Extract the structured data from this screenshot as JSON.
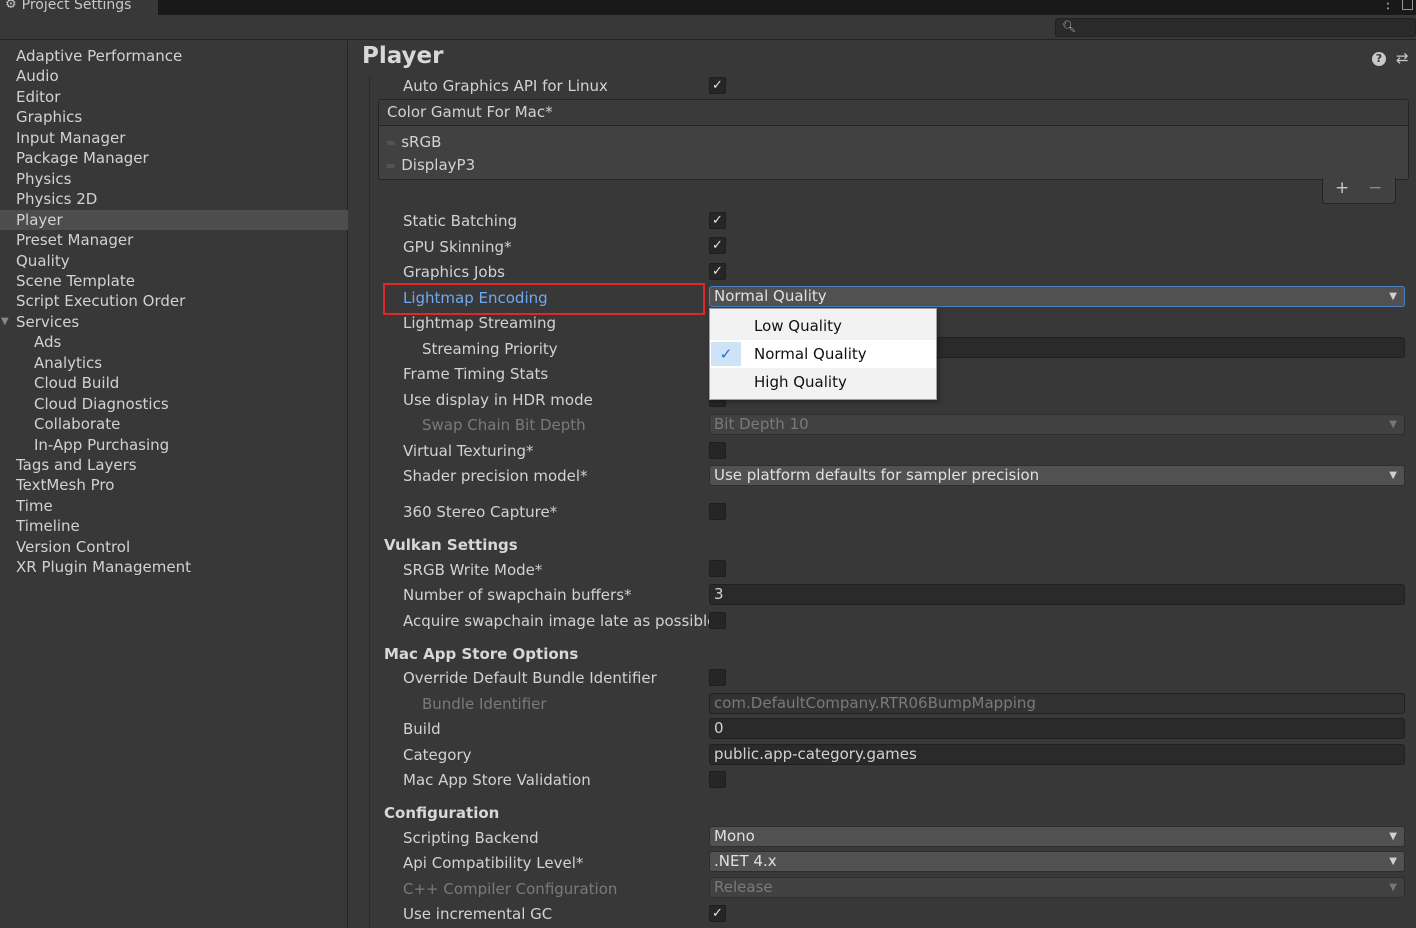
{
  "window": {
    "tab_title": "Project Settings",
    "controls": [
      "⋮",
      "□"
    ]
  },
  "search": {
    "placeholder": "",
    "value": ""
  },
  "sidebar": {
    "items": [
      {
        "label": "Adaptive Performance",
        "indent": 0
      },
      {
        "label": "Audio",
        "indent": 0
      },
      {
        "label": "Editor",
        "indent": 0
      },
      {
        "label": "Graphics",
        "indent": 0
      },
      {
        "label": "Input Manager",
        "indent": 0
      },
      {
        "label": "Package Manager",
        "indent": 0
      },
      {
        "label": "Physics",
        "indent": 0
      },
      {
        "label": "Physics 2D",
        "indent": 0
      },
      {
        "label": "Player",
        "indent": 0,
        "selected": true
      },
      {
        "label": "Preset Manager",
        "indent": 0
      },
      {
        "label": "Quality",
        "indent": 0
      },
      {
        "label": "Scene Template",
        "indent": 0
      },
      {
        "label": "Script Execution Order",
        "indent": 0
      },
      {
        "label": "Services",
        "indent": 0,
        "expanded": true
      },
      {
        "label": "Ads",
        "indent": 1
      },
      {
        "label": "Analytics",
        "indent": 1
      },
      {
        "label": "Cloud Build",
        "indent": 1
      },
      {
        "label": "Cloud Diagnostics",
        "indent": 1
      },
      {
        "label": "Collaborate",
        "indent": 1
      },
      {
        "label": "In-App Purchasing",
        "indent": 1
      },
      {
        "label": "Tags and Layers",
        "indent": 0
      },
      {
        "label": "TextMesh Pro",
        "indent": 0
      },
      {
        "label": "Time",
        "indent": 0
      },
      {
        "label": "Timeline",
        "indent": 0
      },
      {
        "label": "Version Control",
        "indent": 0
      },
      {
        "label": "XR Plugin Management",
        "indent": 0
      }
    ]
  },
  "main": {
    "title": "Player",
    "auto_graphics_api": {
      "label": "Auto Graphics API  for Linux",
      "checked": true
    },
    "color_gamut": {
      "header": "Color Gamut For Mac*",
      "items": [
        "sRGB",
        "DisplayP3"
      ],
      "add": "+",
      "remove": "−"
    },
    "static_batching": {
      "label": "Static Batching",
      "checked": true
    },
    "gpu_skinning": {
      "label": "GPU Skinning*",
      "checked": true
    },
    "graphics_jobs": {
      "label": "Graphics Jobs",
      "checked": true
    },
    "lightmap_encoding": {
      "label": "Lightmap Encoding",
      "value": "Normal Quality"
    },
    "lightmap_streaming": {
      "label": "Lightmap Streaming"
    },
    "streaming_priority": {
      "label": "Streaming Priority"
    },
    "frame_timing_stats": {
      "label": "Frame Timing Stats"
    },
    "hdr_display": {
      "label": "Use display in HDR mode"
    },
    "swap_chain_bit_depth": {
      "label": "Swap Chain Bit Depth",
      "value": "Bit Depth 10"
    },
    "virtual_texturing": {
      "label": "Virtual Texturing*",
      "checked": false
    },
    "shader_precision": {
      "label": "Shader precision model*",
      "value": "Use platform defaults for sampler precision"
    },
    "stereo_capture": {
      "label": "360 Stereo Capture*",
      "checked": false
    },
    "vulkan": {
      "section": "Vulkan Settings",
      "srgb_write": {
        "label": "SRGB Write Mode*",
        "checked": false
      },
      "swapchain_buffers": {
        "label": "Number of swapchain buffers*",
        "value": "3"
      },
      "acquire_late": {
        "label": "Acquire swapchain image late as possible*",
        "checked": false
      }
    },
    "mac_store": {
      "section": "Mac App Store Options",
      "override_bundle": {
        "label": "Override Default Bundle Identifier",
        "checked": false
      },
      "bundle_id": {
        "label": "Bundle Identifier",
        "value": "com.DefaultCompany.RTR06BumpMapping"
      },
      "build": {
        "label": "Build",
        "value": "0"
      },
      "category": {
        "label": "Category",
        "value": "public.app-category.games"
      },
      "validation": {
        "label": "Mac App Store Validation",
        "checked": false
      }
    },
    "configuration": {
      "section": "Configuration",
      "scripting_backend": {
        "label": "Scripting Backend",
        "value": "Mono"
      },
      "api_compat": {
        "label": "Api Compatibility Level*",
        "value": ".NET 4.x"
      },
      "cpp_config": {
        "label": "C++ Compiler Configuration",
        "value": "Release"
      },
      "incremental_gc": {
        "label": "Use incremental GC",
        "checked": true
      }
    }
  },
  "popup": {
    "options": [
      "Low Quality",
      "Normal Quality",
      "High Quality"
    ],
    "selected_index": 1
  },
  "colors": {
    "background": "#383838",
    "highlight_border": "#e02828",
    "focus_label": "#6fa9f2",
    "popup_check": "#1f6fd0"
  }
}
